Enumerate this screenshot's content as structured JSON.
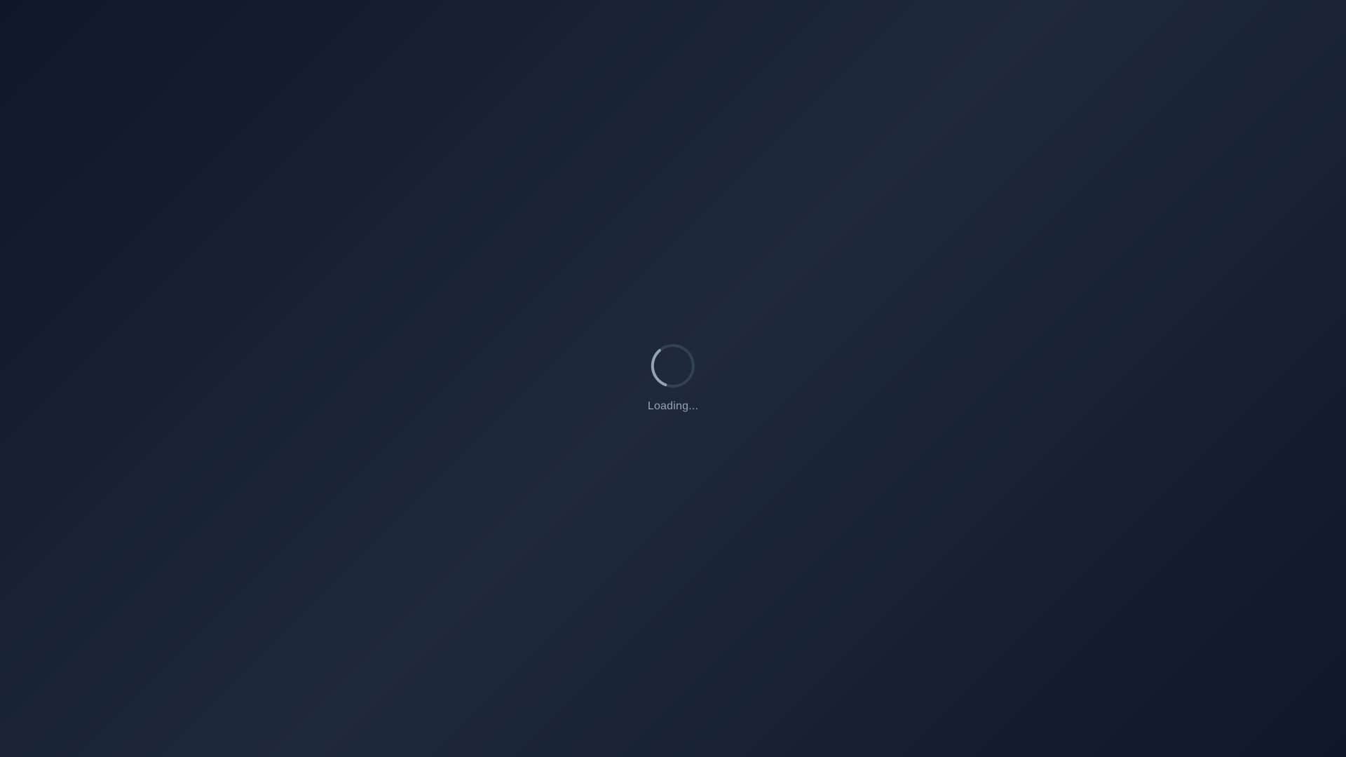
{
  "loading": {
    "text": "Loading...",
    "icon": "loading-spinner-icon"
  },
  "colors": {
    "background_dark": "#0f172a",
    "background_light": "#1e293b",
    "spinner_track": "#334155",
    "spinner_arc": "#94a3b8",
    "text": "#94a3b8"
  }
}
